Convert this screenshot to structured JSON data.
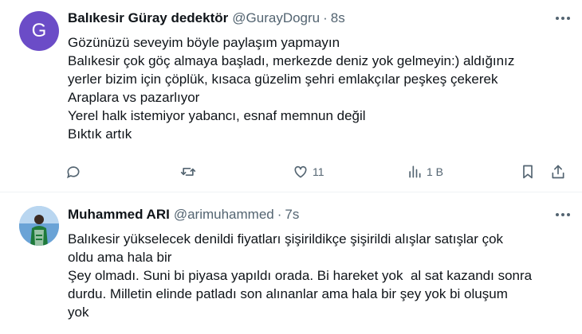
{
  "tweets": [
    {
      "avatar_letter": "G",
      "avatar_color": "#6b4cc7",
      "name": "Balıkesir Güray dedektör",
      "handle": "@GurayDogru",
      "separator": "·",
      "time": "8s",
      "lines": [
        "Gözünüzü seveyim böyle paylaşım yapmayın",
        "Balıkesir çok göç almaya başladı, merkezde deniz yok gelmeyin:) aldığınız",
        "yerler bizim için çöplük, kısaca güzelim şehri emlakçılar peşkeş çekerek",
        "Araplara vs pazarlıyor",
        "Yerel halk istemiyor yabancı, esnaf memnun değil",
        "Bıktık artık"
      ],
      "actions": {
        "reply_icon": "reply-icon",
        "retweet_icon": "retweet-icon",
        "like_icon": "heart-icon",
        "like_count": "11",
        "views_icon": "views-icon",
        "views_count": "1 B",
        "bookmark_icon": "bookmark-icon",
        "share_icon": "share-icon"
      }
    },
    {
      "avatar_icon": "profile-photo",
      "name": "Muhammed ARI",
      "handle": "@arimuhammed",
      "separator": "·",
      "time": "7s",
      "lines": [
        "Balıkesir yükselecek denildi fiyatları şişirildikçe şişirildi alışlar satışlar çok",
        "oldu ama hala bir",
        "Şey olmadı. Suni bi piyasa yapıldı orada. Bi hareket yok  al sat kazandı sonra",
        "durdu. Milletin elinde patladı son alınanlar ama hala bir şey yok bi oluşum",
        "yok"
      ]
    }
  ],
  "colors": {
    "text": "#0f1419",
    "secondary": "#536471",
    "divider": "#eff3f4"
  }
}
